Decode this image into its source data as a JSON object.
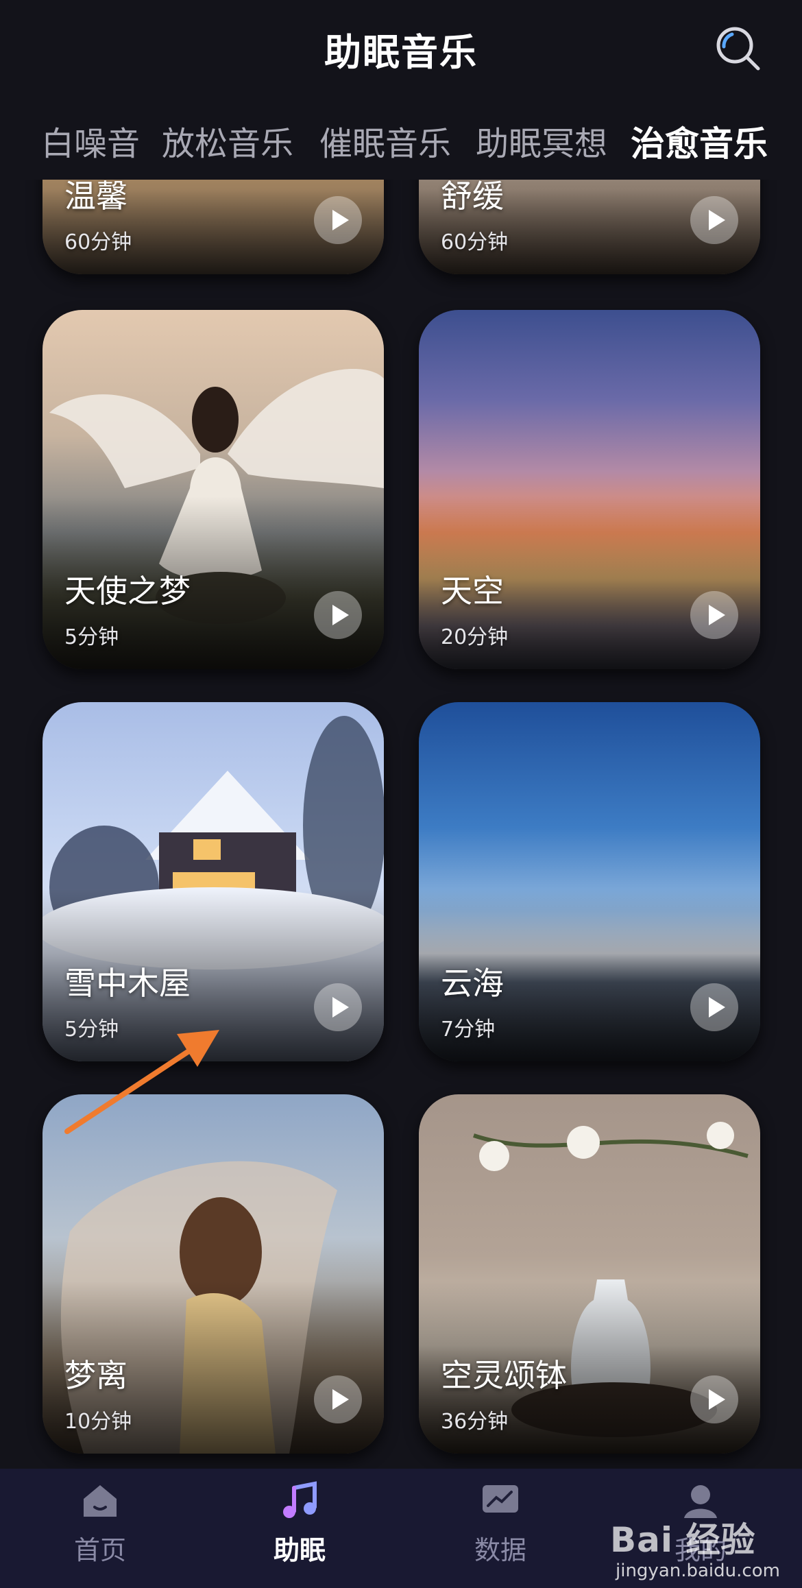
{
  "header": {
    "title": "助眠音乐",
    "search_icon": "search-icon"
  },
  "tabs": [
    {
      "label": "白噪音",
      "active": false
    },
    {
      "label": "放松音乐",
      "active": false
    },
    {
      "label": "催眠音乐",
      "active": false
    },
    {
      "label": "助眠冥想",
      "active": false
    },
    {
      "label": "治愈音乐",
      "active": true
    }
  ],
  "cards": [
    {
      "title": "温馨",
      "duration": "60分钟",
      "icon": "play-icon"
    },
    {
      "title": "舒缓",
      "duration": "60分钟",
      "icon": "play-icon"
    },
    {
      "title": "天使之梦",
      "duration": "5分钟",
      "icon": "play-icon"
    },
    {
      "title": "天空",
      "duration": "20分钟",
      "icon": "play-icon"
    },
    {
      "title": "雪中木屋",
      "duration": "5分钟",
      "icon": "play-icon"
    },
    {
      "title": "云海",
      "duration": "7分钟",
      "icon": "play-icon"
    },
    {
      "title": "梦离",
      "duration": "10分钟",
      "icon": "play-icon"
    },
    {
      "title": "空灵颂钵",
      "duration": "36分钟",
      "icon": "play-icon"
    }
  ],
  "bottom_nav": [
    {
      "label": "首页",
      "icon": "home-icon",
      "active": false
    },
    {
      "label": "助眠",
      "icon": "music-note-icon",
      "active": true
    },
    {
      "label": "数据",
      "icon": "chart-icon",
      "active": false
    },
    {
      "label": "我的",
      "icon": "profile-icon",
      "active": false
    }
  ],
  "watermark": {
    "brand": "Bai 经验",
    "url": "jingyan.baidu.com"
  },
  "colors": {
    "background": "#13131a",
    "nav_background": "#191932",
    "active_text": "#ffffff",
    "inactive_text": "#a9a9b4",
    "annotation_arrow": "#f07b2e"
  }
}
